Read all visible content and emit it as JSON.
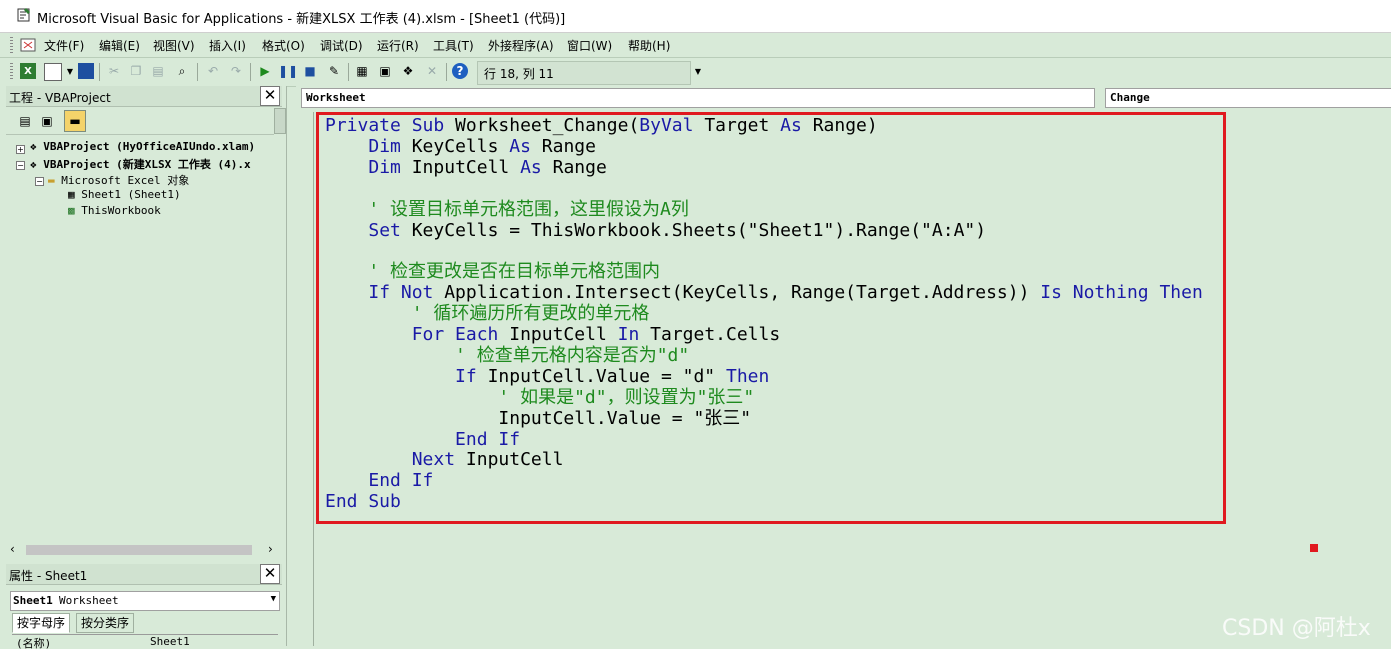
{
  "window": {
    "title": "Microsoft Visual Basic for Applications - 新建XLSX 工作表 (4).xlsm - [Sheet1 (代码)]"
  },
  "menu": {
    "items": [
      "文件(F)",
      "编辑(E)",
      "视图(V)",
      "插入(I)",
      "格式(O)",
      "调试(D)",
      "运行(R)",
      "工具(T)",
      "外接程序(A)",
      "窗口(W)",
      "帮助(H)"
    ]
  },
  "toolbar": {
    "position_text": "行 18, 列 11"
  },
  "project_pane": {
    "title": "工程 - VBAProject",
    "tree": [
      "VBAProject (HyOfficeAIUndo.xlam)",
      "VBAProject (新建XLSX 工作表 (4).x",
      "Microsoft Excel 对象",
      "Sheet1 (Sheet1)",
      "ThisWorkbook"
    ]
  },
  "properties_pane": {
    "title": "属性 - Sheet1",
    "object_name": "Sheet1",
    "object_type": "Worksheet",
    "tabs": [
      "按字母序",
      "按分类序"
    ],
    "row_name": "(名称)",
    "row_value": "Sheet1"
  },
  "code_window": {
    "object_combo": "Worksheet",
    "procedure_combo": "Change",
    "lines": [
      [
        [
          "kw",
          "Private Sub "
        ],
        [
          "tx",
          "Worksheet_Change("
        ],
        [
          "kw",
          "ByVal "
        ],
        [
          "tx",
          "Target "
        ],
        [
          "kw",
          "As "
        ],
        [
          "tx",
          "Range)"
        ]
      ],
      [
        [
          "tx",
          "    "
        ],
        [
          "kw",
          "Dim "
        ],
        [
          "tx",
          "KeyCells "
        ],
        [
          "kw",
          "As "
        ],
        [
          "tx",
          "Range"
        ]
      ],
      [
        [
          "tx",
          "    "
        ],
        [
          "kw",
          "Dim "
        ],
        [
          "tx",
          "InputCell "
        ],
        [
          "kw",
          "As "
        ],
        [
          "tx",
          "Range"
        ]
      ],
      [],
      [
        [
          "tx",
          "    "
        ],
        [
          "cm",
          "' 设置目标单元格范围，这里假设为A列"
        ]
      ],
      [
        [
          "tx",
          "    "
        ],
        [
          "kw",
          "Set "
        ],
        [
          "tx",
          "KeyCells = ThisWorkbook.Sheets(\"Sheet1\").Range(\"A:A\")"
        ]
      ],
      [],
      [
        [
          "tx",
          "    "
        ],
        [
          "cm",
          "' 检查更改是否在目标单元格范围内"
        ]
      ],
      [
        [
          "tx",
          "    "
        ],
        [
          "kw",
          "If Not "
        ],
        [
          "tx",
          "Application.Intersect(KeyCells, Range(Target.Address)) "
        ],
        [
          "kw",
          "Is Nothing Then"
        ]
      ],
      [
        [
          "tx",
          "        "
        ],
        [
          "cm",
          "' 循环遍历所有更改的单元格"
        ]
      ],
      [
        [
          "tx",
          "        "
        ],
        [
          "kw",
          "For Each "
        ],
        [
          "tx",
          "InputCell "
        ],
        [
          "kw",
          "In "
        ],
        [
          "tx",
          "Target.Cells"
        ]
      ],
      [
        [
          "tx",
          "            "
        ],
        [
          "cm",
          "' 检查单元格内容是否为\"d\""
        ]
      ],
      [
        [
          "tx",
          "            "
        ],
        [
          "kw",
          "If "
        ],
        [
          "tx",
          "InputCell.Value = \"d\" "
        ],
        [
          "kw",
          "Then"
        ]
      ],
      [
        [
          "tx",
          "                "
        ],
        [
          "cm",
          "' 如果是\"d\"，则设置为\"张三\""
        ]
      ],
      [
        [
          "tx",
          "                InputCell.Value = \"张三\""
        ]
      ],
      [
        [
          "tx",
          "            "
        ],
        [
          "kw",
          "End If"
        ]
      ],
      [
        [
          "tx",
          "        "
        ],
        [
          "kw",
          "Next "
        ],
        [
          "tx",
          "InputCell"
        ]
      ],
      [
        [
          "tx",
          "    "
        ],
        [
          "kw",
          "End If"
        ]
      ],
      [
        [
          "kw",
          "End Sub"
        ]
      ]
    ]
  },
  "watermark": "CSDN @阿杜x",
  "colors": {
    "background": "#d8ead8",
    "keyword": "#1a1aa6",
    "comment": "#1e8a1e",
    "highlight_border": "#e0191f"
  }
}
